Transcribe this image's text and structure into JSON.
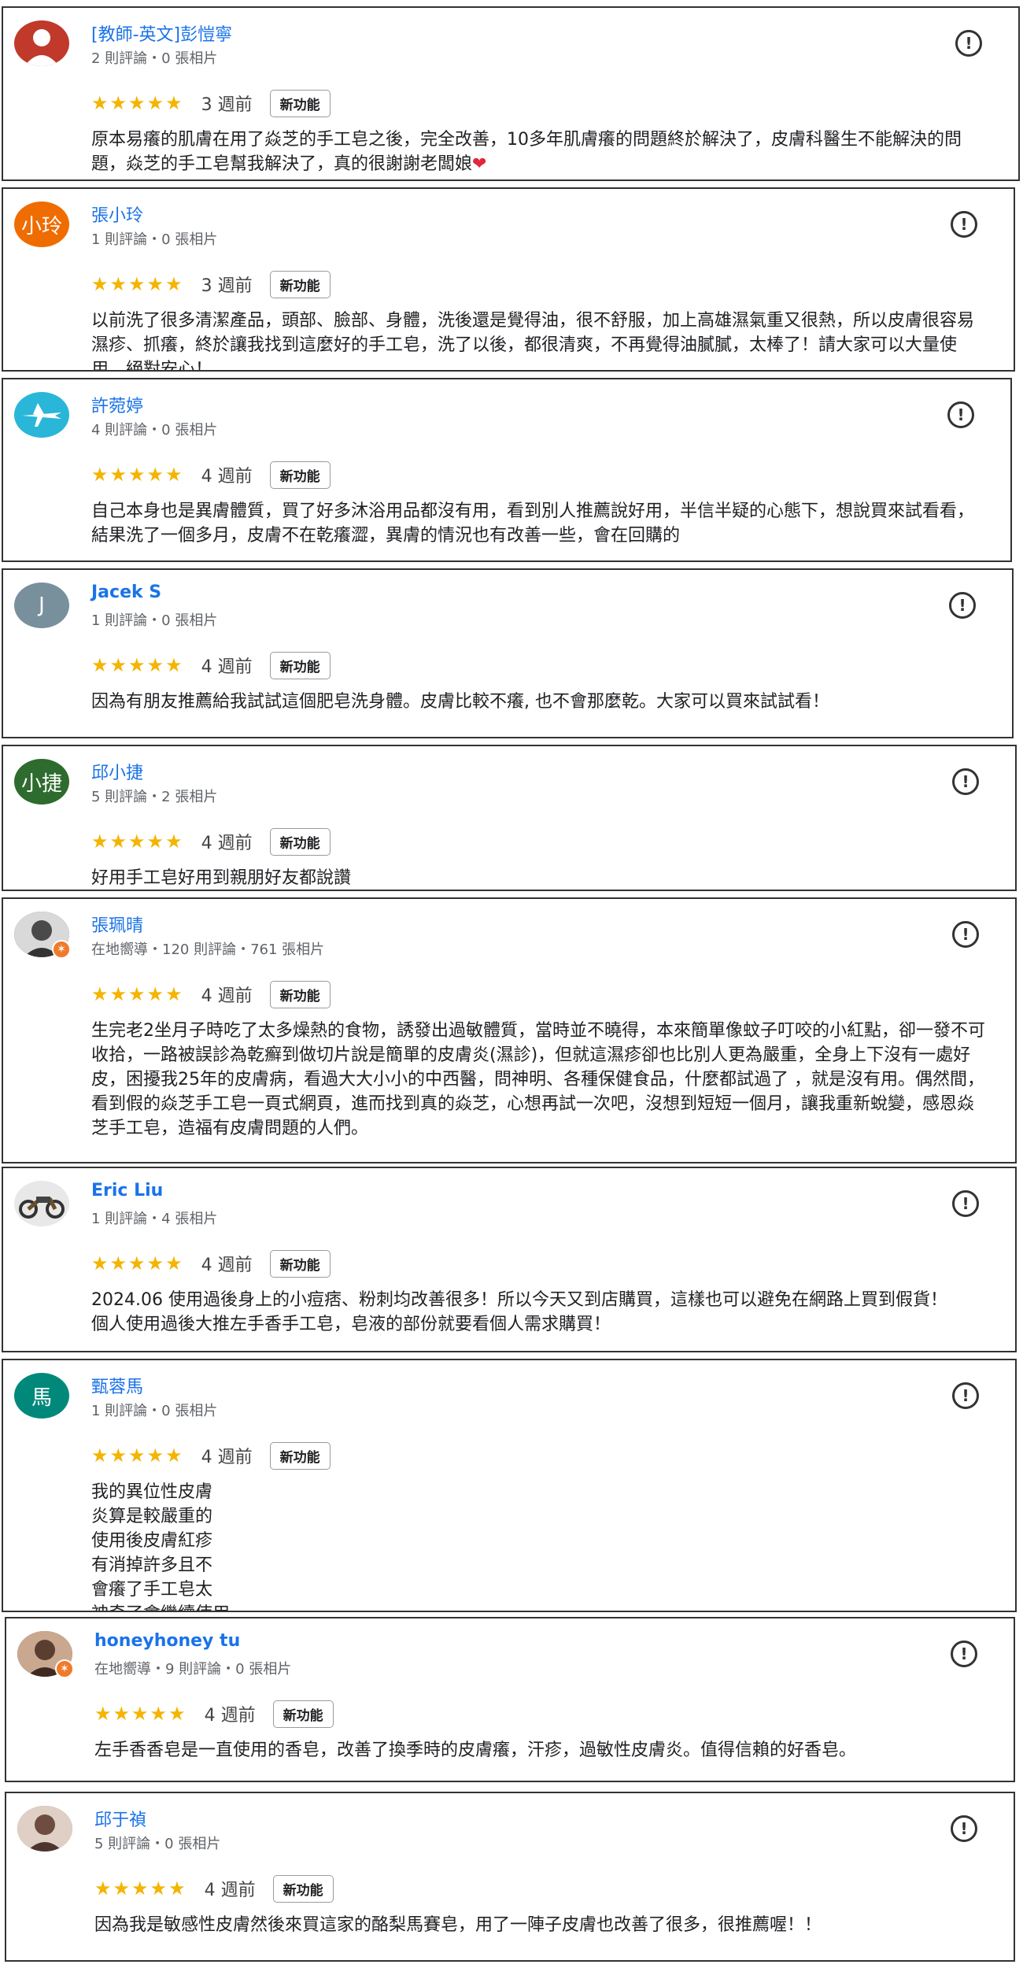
{
  "new_feature_label": "新功能",
  "stars_text": "★★★★★",
  "flag_symbol": "!",
  "reviews": [
    {
      "name": "[教師-英文]彭愷寧",
      "meta": "2 則評論・0 張相片",
      "time": "3 週前",
      "text": "原本易癢的肌膚在用了焱芝的手工皂之後，完全改善，10多年肌膚癢的問題終於解決了，皮膚科醫生不能解決的問題，焱芝的手工皂幫我解決了，真的很謝謝老闆娘",
      "text_suffix": "❤",
      "avatar": {
        "type": "person-icon",
        "bg": "#c0392b"
      }
    },
    {
      "name": "張小玲",
      "meta": "1 則評論・0 張相片",
      "time": "3 週前",
      "text": "以前洗了很多清潔產品，頭部、臉部、身體，洗後還是覺得油，很不舒服，加上高雄濕氣重又很熱，所以皮膚很容易濕疹、抓癢，終於讓我找到這麼好的手工皂，洗了以後，都很清爽，不再覺得油膩膩，太棒了！請大家可以大量使用，絕對安心！",
      "avatar": {
        "type": "text",
        "text": "小玲",
        "bg": "#ef6c00"
      }
    },
    {
      "name": "許菀婷",
      "meta": "4 則評論・0 張相片",
      "time": "4 週前",
      "text": "自己本身也是異膚體質，買了好多沐浴用品都沒有用，看到別人推薦說好用，半信半疑的心態下，想說買來試看看，結果洗了一個多月，皮膚不在乾癢澀，異膚的情況也有改善一些，會在回購的",
      "avatar": {
        "type": "airplane-icon",
        "bg": "#29b6d8"
      }
    },
    {
      "name": "Jacek S",
      "meta": "1 則評論・0 張相片",
      "time": "4 週前",
      "text": "因為有朋友推薦給我試試這個肥皂洗身體。皮膚比較不癢, 也不會那麼乾。大家可以買來試試看！",
      "avatar": {
        "type": "text",
        "text": "J",
        "bg": "#78909c"
      }
    },
    {
      "name": "邱小捷",
      "meta": "5 則評論・2 張相片",
      "time": "4 週前",
      "text": "好用手工皂好用到親朋好友都說讚",
      "avatar": {
        "type": "text",
        "text": "小捷",
        "bg": "#2e6b2e"
      }
    },
    {
      "name": "張珮晴",
      "meta": "在地嚮導・120 則評論・761 張相片",
      "time": "4 週前",
      "text": "生完老2坐月子時吃了太多燥熱的食物，誘發出過敏體質，當時並不曉得，本來簡單像蚊子叮咬的小紅點，卻一發不可收拾，一路被誤診為乾癬到做切片說是簡單的皮膚炎(濕診)，但就這濕疹卻也比別人更為嚴重，全身上下沒有一處好皮，困擾我25年的皮膚病，看過大大小小的中西醫，問神明、各種保健食品，什麼都試過了 ，就是沒有用。偶然間，看到假的焱芝手工皂一頁式網頁，進而找到真的焱芝，心想再試一次吧，沒想到短短一個月，讓我重新蛻變，感恩焱芝手工皂，造福有皮膚問題的人們。",
      "avatar": {
        "type": "photo-icon",
        "bg": "#555555",
        "badge": true
      }
    },
    {
      "name": "Eric Liu",
      "meta": "1 則評論・4 張相片",
      "time": "4 週前",
      "text": "2024.06 使用過後身上的小痘痞、粉刺均改善很多！所以今天又到店購買，這樣也可以避免在網路上買到假貨！\n個人使用過後大推左手香手工皂，皂液的部份就要看個人需求購買！",
      "avatar": {
        "type": "motorcycle-icon",
        "bg": "#e8e8e8"
      }
    },
    {
      "name": "甄蓉馬",
      "meta": "1 則評論・0 張相片",
      "time": "4 週前",
      "text": "我的異位性皮膚\n炎算是較嚴重的\n使用後皮膚紅疹\n有消掉許多且不\n會癢了手工皂太\n神奇了會繼續使用",
      "avatar": {
        "type": "text",
        "text": "馬",
        "bg": "#00897b"
      }
    },
    {
      "name": "honeyhoney tu",
      "meta": "在地嚮導・9 則評論・0 張相片",
      "time": "4 週前",
      "text": "左手香香皂是一直使用的香皂，改善了換季時的皮膚癢，汗疹，過敏性皮膚炎。值得信賴的好香皂。",
      "avatar": {
        "type": "photo-icon",
        "bg": "#7a5c4a",
        "badge": true
      }
    },
    {
      "name": "邱于禎",
      "meta": "5 則評論・0 張相片",
      "time": "4 週前",
      "text": "因為我是敏感性皮膚然後來買這家的酪梨馬賽皂，用了一陣子皮膚也改善了很多，很推薦喔！！",
      "avatar": {
        "type": "photo-icon",
        "bg": "#8d6e63"
      }
    }
  ]
}
